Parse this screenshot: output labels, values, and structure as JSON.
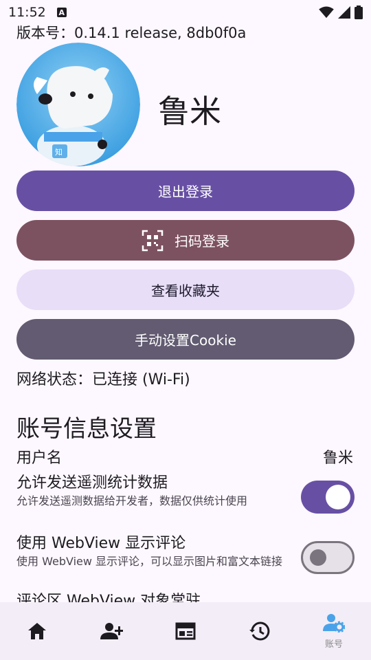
{
  "status_bar": {
    "time": "11:52",
    "notification_icon": "A"
  },
  "version_text": "版本号：0.14.1 release, 8db0f0a",
  "profile": {
    "name": "鲁米"
  },
  "buttons": {
    "logout": "退出登录",
    "scan_login": "扫码登录",
    "favorites": "查看收藏夹",
    "manual_cookie": "手动设置Cookie"
  },
  "network_status": "网络状态：已连接 (Wi-Fi)",
  "settings": {
    "section_title": "账号信息设置",
    "username_label": "用户名",
    "username_value": "鲁米",
    "telemetry": {
      "label": "允许发送遥测统计数据",
      "description": "允许发送遥测数据给开发者，数据仅供统计使用",
      "enabled": true
    },
    "webview_comments": {
      "label": "使用 WebView 显示评论",
      "description": "使用 WebView 显示评论，可以显示图片和富文本链接",
      "enabled": false
    },
    "webview_resident": {
      "label": "评论区 WebView 对象常驻"
    }
  },
  "bottom_nav": {
    "items": [
      {
        "icon": "home-icon"
      },
      {
        "icon": "person-add-icon"
      },
      {
        "icon": "newspaper-icon"
      },
      {
        "icon": "history-icon"
      },
      {
        "icon": "account-settings-icon",
        "label": "账号"
      }
    ]
  },
  "colors": {
    "primary": "#6750a4",
    "tertiary": "#7d5260",
    "secondary_container": "#e8def8",
    "secondary": "#625b71",
    "background": "#fdf7ff",
    "nav_active": "#4aa3e8"
  }
}
